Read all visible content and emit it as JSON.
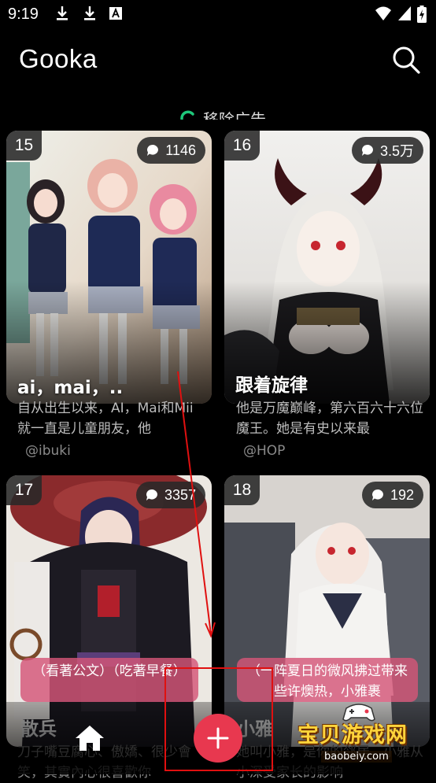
{
  "status_bar": {
    "time": "9:19"
  },
  "app": {
    "title": "Gooka"
  },
  "ad": {
    "label": "移除广告"
  },
  "cards": [
    {
      "rank": "15",
      "comments": "1146",
      "title": "ai，mai，..",
      "desc": "自从出生以来，AI，Mai和Mii就一直是儿童朋友，他",
      "author": "@ibuki"
    },
    {
      "rank": "16",
      "comments": "3.5万",
      "title": "跟着旋律",
      "desc": "他是万魔巅峰，第六百六十六位魔王。她是有史以来最",
      "author": "@HOP"
    },
    {
      "rank": "17",
      "comments": "3357",
      "bubble": "（看著公文）（吃著早餐）",
      "name": "散兵",
      "desc": "刀子嘴豆腐心、傲嬌、很少會笑，其實內心很喜歡你"
    },
    {
      "rank": "18",
      "comments": "192",
      "bubble": "（一阵夏日的微风拂过带来些许燠热，小雅裹",
      "name": "小雅",
      "desc": "她叫小雅，是你的邻居，小雅从小深受家长的影响"
    }
  ],
  "watermark": {
    "title": "宝贝游戏网",
    "url": "baobeiy.com"
  },
  "colors": {
    "background": "#000000",
    "accent": "#e8384f",
    "highlight_box": "#e01010"
  }
}
